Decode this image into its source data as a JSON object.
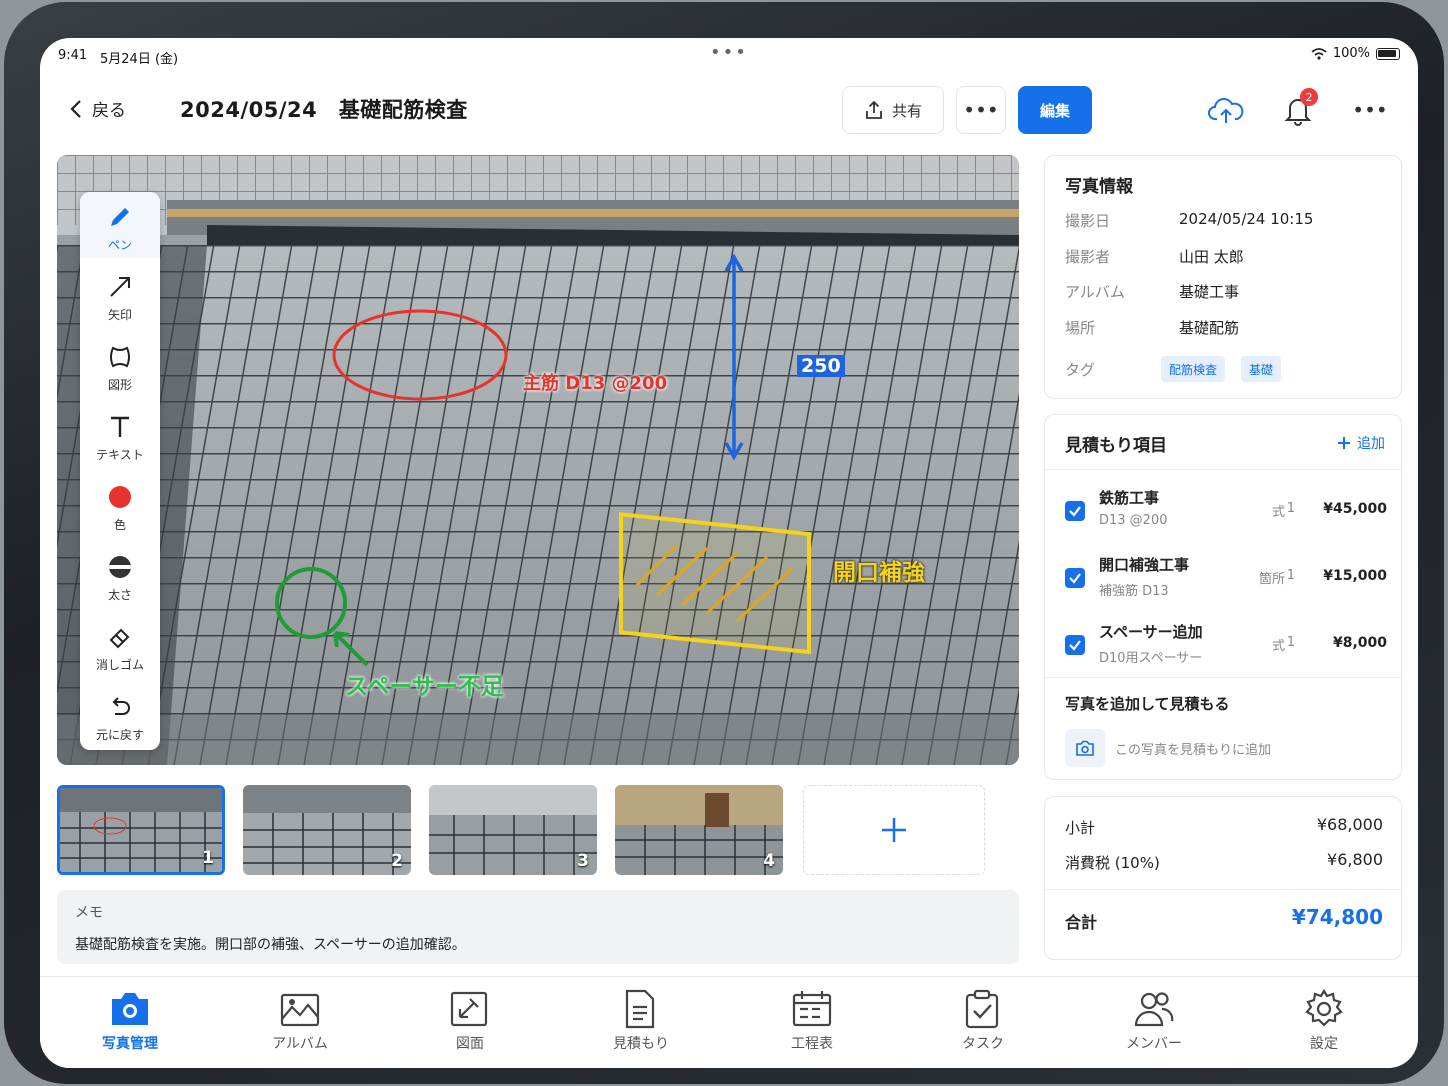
{
  "status_bar": {
    "time": "9:41",
    "date": "5月24日 (金)",
    "battery": "100%"
  },
  "header": {
    "back_label": "戻る",
    "title": "2024/05/24　基礎配筋検査",
    "share_label": "共有",
    "edit_label": "編集",
    "notification_count": "2"
  },
  "tools": [
    {
      "label": "ペン",
      "icon": "pen-icon"
    },
    {
      "label": "矢印",
      "icon": "arrow-icon"
    },
    {
      "label": "図形",
      "icon": "shape-icon"
    },
    {
      "label": "テキスト",
      "icon": "text-icon"
    },
    {
      "label": "色",
      "icon": "color-icon",
      "color": "#e8322e"
    },
    {
      "label": "太さ",
      "icon": "stroke-width-icon"
    },
    {
      "label": "消しゴム",
      "icon": "eraser-icon"
    },
    {
      "label": "元に戻す",
      "icon": "undo-icon"
    }
  ],
  "annotations": {
    "rebar_note": "主筋 D13 @200",
    "dimension": "250",
    "opening_note": "開口補強",
    "spacer_note": "スペーサー不足"
  },
  "thumbnails": [
    "1",
    "2",
    "3",
    "4"
  ],
  "memo": {
    "label": "メモ",
    "text": "基礎配筋検査を実施。開口部の補強、スペーサーの追加確認。"
  },
  "photo_info": {
    "title": "写真情報",
    "rows": [
      {
        "label": "撮影日",
        "value": "2024/05/24 10:15"
      },
      {
        "label": "撮影者",
        "value": "山田 太郎"
      },
      {
        "label": "アルバム",
        "value": "基礎工事"
      },
      {
        "label": "場所",
        "value": "基礎配筋"
      }
    ],
    "tags_label": "タグ",
    "tags": [
      "配筋検査",
      "基礎"
    ]
  },
  "estimate": {
    "title": "見積もり項目",
    "add_label": "追加",
    "items": [
      {
        "name": "鉄筋工事",
        "sub": "D13 @200",
        "unit": "式",
        "qty": "1",
        "price": "¥45,000"
      },
      {
        "name": "開口補強工事",
        "sub": "補強筋 D13",
        "unit": "箇所",
        "qty": "1",
        "price": "¥15,000"
      },
      {
        "name": "スペーサー追加",
        "sub": "D10用スペーサー",
        "unit": "式",
        "qty": "1",
        "price": "¥8,000"
      }
    ],
    "add_photo_title": "写真を追加して見積もる",
    "add_photo_text": "この写真を見積もりに追加"
  },
  "totals": {
    "subtotal_label": "小計",
    "subtotal": "¥68,000",
    "tax_label": "消費税 (10%)",
    "tax": "¥6,800",
    "total_label": "合計",
    "total": "¥74,800"
  },
  "tabs": [
    {
      "label": "写真管理",
      "icon": "camera-icon",
      "active": true
    },
    {
      "label": "アルバム",
      "icon": "album-icon"
    },
    {
      "label": "図面",
      "icon": "drawing-icon"
    },
    {
      "label": "見積もり",
      "icon": "estimate-icon"
    },
    {
      "label": "工程表",
      "icon": "schedule-icon"
    },
    {
      "label": "タスク",
      "icon": "task-icon"
    },
    {
      "label": "メンバー",
      "icon": "members-icon"
    },
    {
      "label": "設定",
      "icon": "settings-icon"
    }
  ],
  "colors": {
    "accent": "#1670ea",
    "annot_red": "#e8322e",
    "annot_green": "#1f9b3a",
    "annot_yellow": "#f5d31a",
    "annot_blue": "#1e63e0"
  }
}
